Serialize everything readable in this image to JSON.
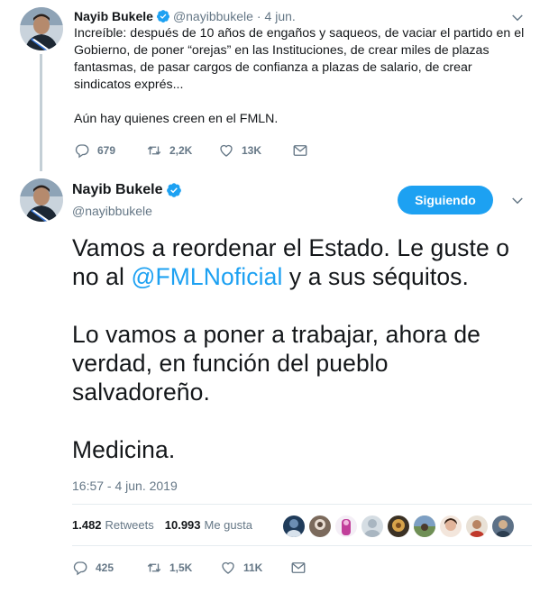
{
  "parent_tweet": {
    "name": "Nayib Bukele",
    "handle": "@nayibbukele",
    "separator": "·",
    "date": "4 jun.",
    "text_lines": [
      "Increíble: después de 10 años de engaños y saqueos, de vaciar el partido en el",
      "Gobierno, de poner “orejas” en las Instituciones, de crear miles de plazas",
      "fantasmas, de pasar cargos de confianza a plazas de salario, de crear",
      "sindicatos exprés...",
      "Aún hay quienes creen en el FMLN."
    ],
    "replies": "679",
    "retweets": "2,2K",
    "likes": "13K"
  },
  "main_tweet": {
    "name": "Nayib Bukele",
    "handle": "@nayibbukele",
    "follow_label": "Siguiendo",
    "text": {
      "line1": "Vamos a reordenar el Estado. Le guste o",
      "line2_before": "no al ",
      "line2_mention": "@FMLNoficial",
      "line2_after": " y a sus séquitos.",
      "line3": "Lo vamos a poner a trabajar, ahora de",
      "line4": "verdad, en función del pueblo",
      "line5": "salvadoreño.",
      "line6": "Medicina."
    },
    "timestamp": "16:57 - 4 jun. 2019",
    "retweets_count": "1.482",
    "retweets_label": "Retweets",
    "likes_count": "10.993",
    "likes_label": "Me gusta",
    "replies": "425",
    "retweets": "1,5K",
    "likes": "11K"
  },
  "icons": [
    "verified-badge-icon",
    "chevron-down-icon",
    "reply-icon",
    "retweet-icon",
    "like-icon",
    "direct-message-icon"
  ],
  "colors": {
    "accent": "#1da1f2",
    "muted": "#657786",
    "text": "#14171a",
    "thread": "#c4cfd6"
  }
}
